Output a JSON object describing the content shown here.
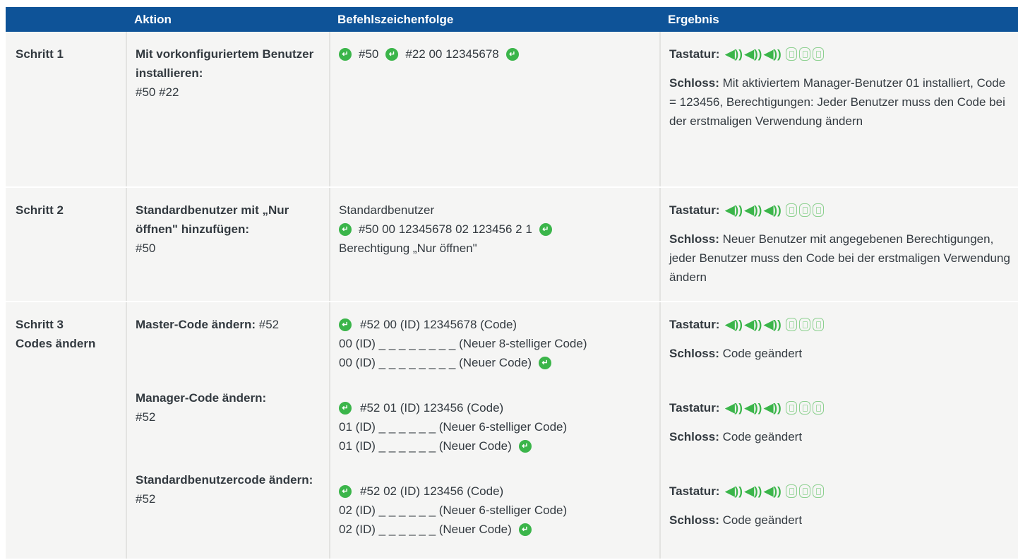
{
  "header": {
    "col1": "",
    "col2": "Aktion",
    "col3": "Befehlszeichenfolge",
    "col4": "Ergebnis"
  },
  "kbd_label": "Tastatur:",
  "lock_label": "Schloss:",
  "enter_glyph": "↵",
  "speaker_glyph": "◀))",
  "accent_colors": {
    "header": "#0e5398",
    "green": "#3bb54a"
  },
  "row1": {
    "step": "Schritt 1",
    "action_bold": "Mit vorkonfiguriertem Benutzer installieren:",
    "action_code": "#50 #22",
    "seq_a": "#50",
    "seq_b": "#22 00 12345678",
    "lock_text": "Mit aktiviertem Manager-Benutzer 01 installiert, Code = 123456, Berechtigungen: Jeder Benutzer muss den Code bei der erstmaligen Verwendung ändern"
  },
  "row2": {
    "step": "Schritt 2",
    "action_bold": "Standardbenutzer mit „Nur öffnen\" hinzufügen:",
    "action_code": "#50",
    "seq_title": "Standardbenutzer",
    "seq_line": "#50 00 12345678 02 123456 2 1",
    "seq_note": "Berechtigung „Nur öffnen\"",
    "lock_text": "Neuer Benutzer mit angegebenen Berechtigungen, jeder Benutzer muss den Code bei der erstmaligen Verwendung ändern"
  },
  "row3": {
    "step_line1": "Schritt 3",
    "step_line2": "Codes ändern",
    "sub1": {
      "action_bold": "Master-Code ändern:",
      "action_code": "#52",
      "seq1": "#52 00 (ID) 12345678 (Code)",
      "seq2": "00 (ID) _ _ _ _ _ _ _ _ (Neuer 8-stelliger Code)",
      "seq3": "00 (ID) _ _ _ _ _ _ _ _ (Neuer Code)",
      "lock_text": "Code geändert"
    },
    "sub2": {
      "action_bold": "Manager-Code ändern:",
      "action_code": "#52",
      "seq1": "#52 01 (ID) 123456 (Code)",
      "seq2": "01 (ID) _ _ _ _ _ _ (Neuer 6-stelliger Code)",
      "seq3": "01 (ID) _ _ _ _ _ _ (Neuer Code)",
      "lock_text": "Code geändert"
    },
    "sub3": {
      "action_bold": "Standardbenutzercode ändern:",
      "action_code": "#52",
      "seq1": "#52 02 (ID) 123456 (Code)",
      "seq2": "02 (ID) _ _ _ _ _ _ (Neuer 6-stelliger Code)",
      "seq3": "02 (ID) _ _ _ _ _ _ (Neuer Code)",
      "lock_text": "Code geändert"
    }
  }
}
